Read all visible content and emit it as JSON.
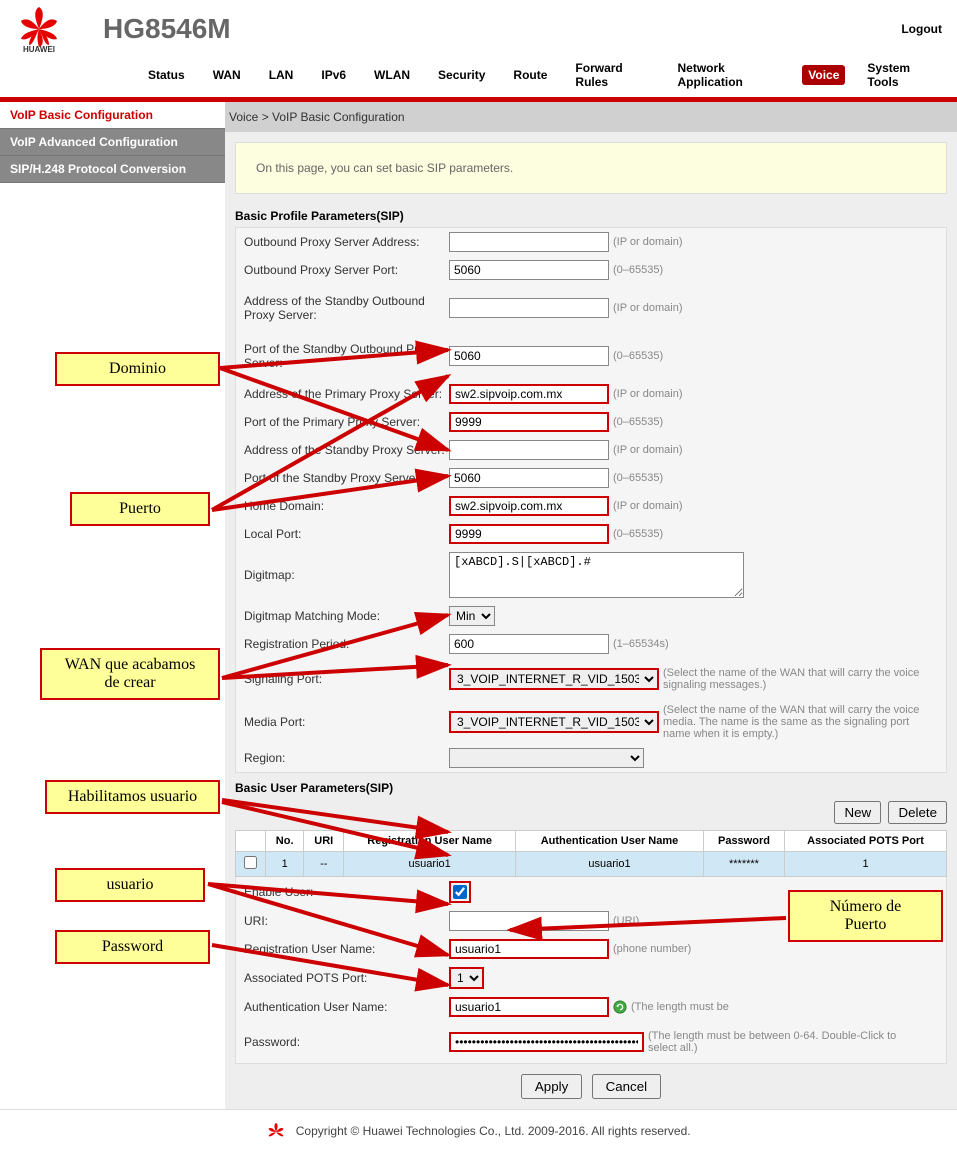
{
  "header": {
    "model": "HG8546M",
    "brand": "HUAWEI",
    "logout": "Logout"
  },
  "topnav": [
    "Status",
    "WAN",
    "LAN",
    "IPv6",
    "WLAN",
    "Security",
    "Route",
    "Forward Rules",
    "Network Application",
    "Voice",
    "System Tools"
  ],
  "topnav_active": "Voice",
  "sidenav": [
    {
      "label": "VoIP Basic Configuration",
      "active": true
    },
    {
      "label": "VoIP Advanced Configuration",
      "active": false
    },
    {
      "label": "SIP/H.248 Protocol Conversion",
      "active": false
    }
  ],
  "breadcrumb": "Voice > VoIP Basic Configuration",
  "page_hint": "On this page, you can set basic SIP parameters.",
  "sections": {
    "profile_title": "Basic Profile Parameters(SIP)",
    "user_title": "Basic User Parameters(SIP)"
  },
  "profile": {
    "outbound_addr_label": "Outbound Proxy Server Address:",
    "outbound_addr": "",
    "ip_domain_hint": "(IP or domain)",
    "outbound_port_label": "Outbound Proxy Server Port:",
    "outbound_port": "5060",
    "port_hint": "(0–65535)",
    "standby_out_addr_label": "Address of the Standby Outbound Proxy Server:",
    "standby_out_addr": "",
    "standby_out_port_label": "Port of the Standby Outbound Proxy Server:",
    "standby_out_port": "5060",
    "primary_addr_label": "Address of the Primary Proxy Server:",
    "primary_addr": "sw2.sipvoip.com.mx",
    "primary_port_label": "Port of the Primary Proxy Server:",
    "primary_port": "9999",
    "standby_addr_label": "Address of the Standby Proxy Server:",
    "standby_addr": "",
    "standby_port_label": "Port of the Standby Proxy Server:",
    "standby_port": "5060",
    "home_domain_label": "Home Domain:",
    "home_domain": "sw2.sipvoip.com.mx",
    "local_port_label": "Local Port:",
    "local_port": "9999",
    "digitmap_label": "Digitmap:",
    "digitmap": "[xABCD].S|[xABCD].#",
    "digitmap_mode_label": "Digitmap Matching Mode:",
    "digitmap_mode": "Min",
    "reg_period_label": "Registration Period:",
    "reg_period": "600",
    "reg_period_hint": "(1–65534s)",
    "signaling_label": "Signaling Port:",
    "signaling": "3_VOIP_INTERNET_R_VID_1503",
    "signaling_hint": "(Select the name of the WAN that will carry the voice signaling messages.)",
    "media_label": "Media Port:",
    "media": "3_VOIP_INTERNET_R_VID_1503",
    "media_hint": "(Select the name of the WAN that will carry the voice media. The name is the same as the signaling port name when it is empty.)",
    "region_label": "Region:",
    "region": ""
  },
  "user_buttons": {
    "new": "New",
    "delete": "Delete",
    "apply": "Apply",
    "cancel": "Cancel"
  },
  "user_table": {
    "headers": {
      "no": "No.",
      "uri": "URI",
      "reg": "Registration User Name",
      "auth": "Authentication User Name",
      "pwd": "Password",
      "pots": "Associated POTS Port"
    },
    "row": {
      "no": "1",
      "uri": "--",
      "reg": "usuario1",
      "auth": "usuario1",
      "pwd": "*******",
      "pots": "1"
    }
  },
  "user_form": {
    "enable_label": "Enable User:",
    "enable": true,
    "uri_label": "URI:",
    "uri": "",
    "uri_hint": "(URI)",
    "reg_label": "Registration User Name:",
    "reg": "usuario1",
    "reg_hint": "(phone number)",
    "pots_label": "Associated POTS Port:",
    "pots": "1",
    "auth_label": "Authentication User Name:",
    "auth": "usuario1",
    "auth_hint": "(The length must be",
    "pwd_label": "Password:",
    "pwd": "••••••••••••••••••••••••••••••••••••••••••••••••••••",
    "pwd_hint": "(The length must be between 0-64. Double-Click to select all.)"
  },
  "footer": "Copyright © Huawei Technologies Co., Ltd. 2009-2016. All rights reserved.",
  "callouts": {
    "dominio": "Dominio",
    "puerto": "Puerto",
    "wan": "WAN que acabamos de crear",
    "habilitamos": "Habilitamos usuario",
    "usuario": "usuario",
    "password": "Password",
    "numero_puerto": "Número de Puerto"
  }
}
